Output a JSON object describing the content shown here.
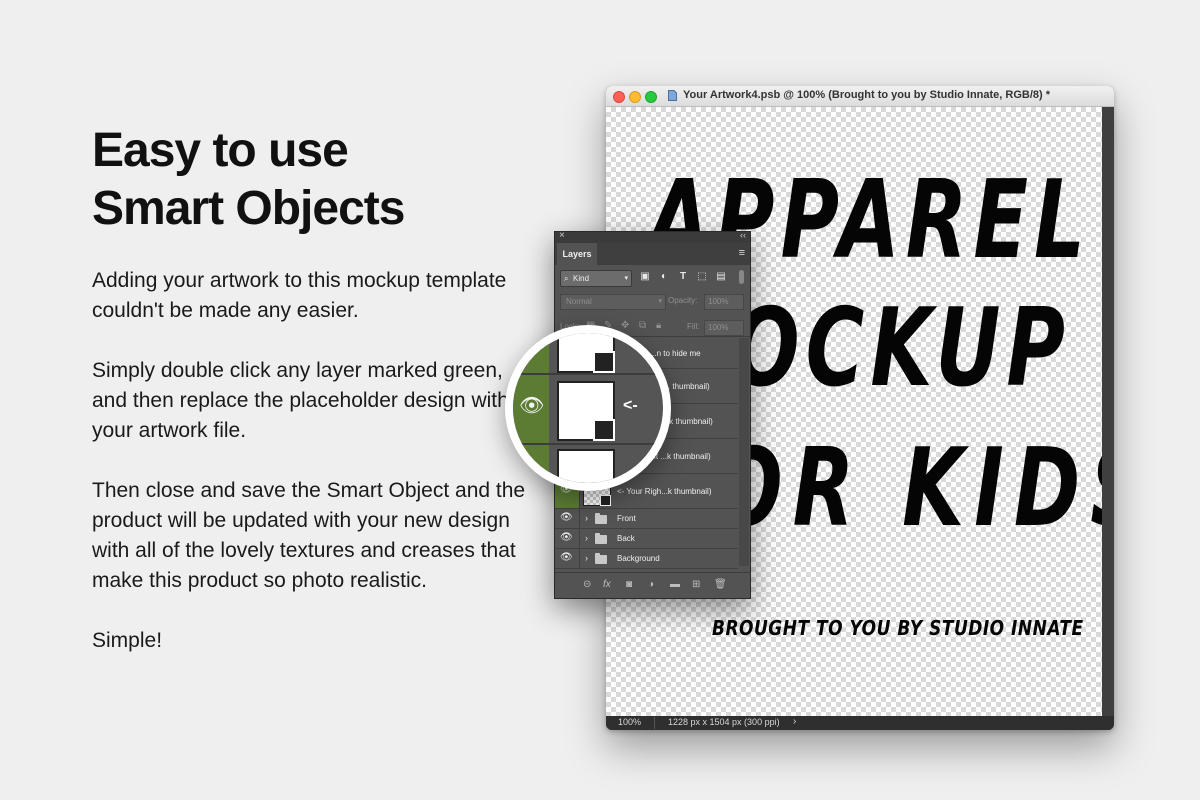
{
  "headline": {
    "line1": "Easy to use",
    "line2": "Smart Objects"
  },
  "paragraphs": [
    "Adding your artwork to this mockup template couldn't be made any easier.",
    "Simply double click any layer marked green, and then replace the placeholder design with your artwork file.",
    "Then close and save the Smart Object and the product will be updated with your new design with all of the lovely textures and creases that make this product so photo realistic.",
    "Simple!"
  ],
  "window": {
    "title": "Your Artwork4.psb @ 100% (Brought to you by Studio Innate, RGB/8) *",
    "doc_icon": "document-icon"
  },
  "artwork": {
    "line1": "APPAREL",
    "line2": "MOCKUP",
    "line3": "FOR KIDS",
    "tagline": "BROUGHT TO YOU BY STUDIO INNATE"
  },
  "statusbar": {
    "zoom": "100%",
    "info": "1228 px x 1504 px (300 ppi)",
    "arrow": "›"
  },
  "layers_panel": {
    "close": "×",
    "collapse": "‹‹",
    "tab": "Layers",
    "menu_icon": "≡",
    "kind_label": "Kind",
    "blend_mode": "Normal",
    "opacity_label": "Opacity:",
    "opacity_value": "100%",
    "lock_label": "Lock:",
    "fill_label": "Fill:",
    "fill_value": "100%",
    "layers": [
      {
        "name": "Click the ...n to hide me"
      },
      {
        "name": "<- Your Ches... thumbnail)"
      },
      {
        "name": "<- Your Back...k thumbnail)"
      },
      {
        "name": "<- Your Left ...k thumbnail)"
      },
      {
        "name": "<- Your Righ...k thumbnail)"
      },
      {
        "name": "Front"
      },
      {
        "name": "Back"
      },
      {
        "name": "Background"
      }
    ],
    "magnifier_arrow": "<-"
  },
  "colors": {
    "smart_object_green": "#5c7c33",
    "panel_bg": "#535353",
    "page_bg": "#efefef"
  }
}
